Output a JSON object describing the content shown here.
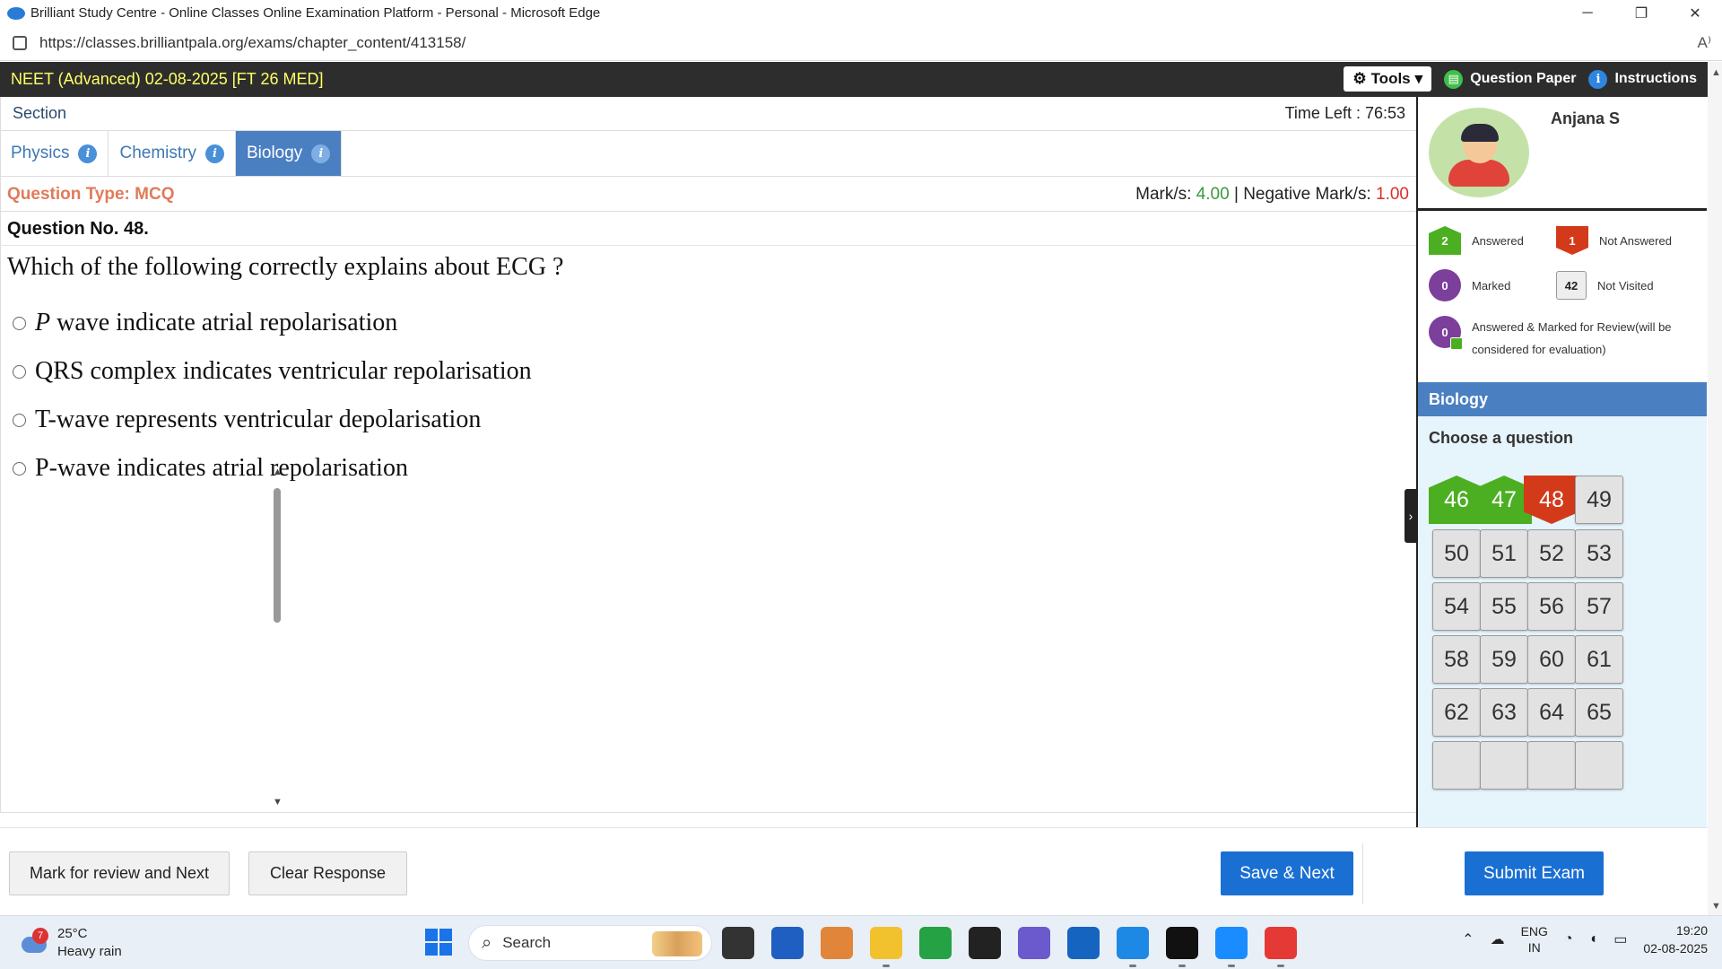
{
  "window": {
    "title": "Brilliant Study Centre - Online Classes Online Examination Platform - Personal - Microsoft Edge",
    "url": "https://classes.brilliantpala.org/exams/chapter_content/413158/",
    "controls": {
      "minimize": "─",
      "maximize": "❐",
      "close": "✕"
    },
    "read_aloud": "A⁾"
  },
  "exam_header": {
    "title": "NEET (Advanced) 02-08-2025 [FT 26 MED]",
    "tools_label": "Tools",
    "tools_icon": "⚙",
    "tools_caret": "▾",
    "question_paper_label": "Question Paper",
    "question_paper_icon": "▤",
    "instructions_label": "Instructions",
    "instructions_icon": "i"
  },
  "section_bar": {
    "label": "Section",
    "time_left": "Time Left : 76:53"
  },
  "tabs": [
    {
      "label": "Physics",
      "info": "i"
    },
    {
      "label": "Chemistry",
      "info": "i"
    },
    {
      "label": "Biology",
      "info": "i"
    }
  ],
  "question_meta": {
    "type": "Question Type: MCQ",
    "marks_label": "Mark/s:",
    "marks_value": "4.00",
    "separator": "|",
    "negative_label": "Negative Mark/s:",
    "negative_value": "1.00",
    "number": "Question No. 48."
  },
  "question": {
    "text": "Which of the following correctly explains about ECG ?",
    "options": [
      {
        "lead": "P",
        "text": " wave indicate atrial repolarisation"
      },
      {
        "lead": "",
        "text": "QRS complex indicates ventricular repolarisation"
      },
      {
        "lead": "",
        "text": "T-wave represents ventricular depolarisation"
      },
      {
        "lead": "",
        "text": "P-wave indicates atrial repolarisation"
      }
    ]
  },
  "footer": {
    "mark_review": "Mark for review and Next",
    "clear": "Clear Response",
    "save_next": "Save & Next",
    "submit": "Submit Exam"
  },
  "panel": {
    "collapse_arrow": "›",
    "user_name": "Anjana S",
    "legend": {
      "answered": {
        "count": "2",
        "label": "Answered"
      },
      "not_answered": {
        "count": "1",
        "label": "Not Answered"
      },
      "marked": {
        "count": "0",
        "label": "Marked"
      },
      "not_visited": {
        "count": "42",
        "label": "Not Visited"
      },
      "answered_marked": {
        "count": "0",
        "label": "Answered & Marked for Review(will be considered for evaluation)"
      }
    },
    "section_name": "Biology",
    "choose_label": "Choose a question",
    "questions": [
      {
        "n": "46",
        "status": "answered"
      },
      {
        "n": "47",
        "status": "answered"
      },
      {
        "n": "48",
        "status": "not_answered"
      },
      {
        "n": "49",
        "status": "not_visited"
      },
      {
        "n": "50",
        "status": "not_visited"
      },
      {
        "n": "51",
        "status": "not_visited"
      },
      {
        "n": "52",
        "status": "not_visited"
      },
      {
        "n": "53",
        "status": "not_visited"
      },
      {
        "n": "54",
        "status": "not_visited"
      },
      {
        "n": "55",
        "status": "not_visited"
      },
      {
        "n": "56",
        "status": "not_visited"
      },
      {
        "n": "57",
        "status": "not_visited"
      },
      {
        "n": "58",
        "status": "not_visited"
      },
      {
        "n": "59",
        "status": "not_visited"
      },
      {
        "n": "60",
        "status": "not_visited"
      },
      {
        "n": "61",
        "status": "not_visited"
      },
      {
        "n": "62",
        "status": "not_visited"
      },
      {
        "n": "63",
        "status": "not_visited"
      },
      {
        "n": "64",
        "status": "not_visited"
      },
      {
        "n": "65",
        "status": "not_visited"
      },
      {
        "n": "",
        "status": "not_visited"
      },
      {
        "n": "",
        "status": "not_visited"
      },
      {
        "n": "",
        "status": "not_visited"
      },
      {
        "n": "",
        "status": "not_visited"
      }
    ],
    "scroll_up": "▲",
    "scroll_down": "▼"
  },
  "page_scroll": {
    "up": "▲",
    "down": "▼"
  },
  "colors": {
    "header_bg": "#2d2d2d",
    "exam_title": "#ffff66",
    "tab_active": "#4a7fc1",
    "answered": "#4caf22",
    "not_answered": "#d33a1a",
    "marked": "#7c3f9b",
    "button_blue": "#1a6fd3",
    "panel_bg": "#e6f4fb"
  },
  "taskbar": {
    "weather_temp": "25°C",
    "weather_desc": "Heavy rain",
    "weather_badge": "7",
    "search_placeholder": "Search",
    "search_icon": "⌕",
    "apps": [
      {
        "name": "task-view-icon",
        "color": "#333"
      },
      {
        "name": "microsoft-store-icon",
        "color": "#1f5fc2"
      },
      {
        "name": "copilot-icon",
        "color": "#e0853a"
      },
      {
        "name": "file-explorer-icon",
        "color": "#f2c12e"
      },
      {
        "name": "whatsapp-icon",
        "color": "#25a244"
      },
      {
        "name": "dell-icon",
        "color": "#222"
      },
      {
        "name": "teams-icon",
        "color": "#6a5acd"
      },
      {
        "name": "outlook-icon",
        "color": "#1565c0"
      },
      {
        "name": "edge-icon",
        "color": "#1e88e5"
      },
      {
        "name": "webex-icon",
        "color": "#111"
      },
      {
        "name": "app-blue-icon",
        "color": "#1a8cff"
      },
      {
        "name": "chrome-icon",
        "color": "#e53935"
      }
    ],
    "tray_chevron": "⌃",
    "tray_cloud": "☁",
    "lang_top": "ENG",
    "lang_bottom": "IN",
    "wifi_icon": "◔",
    "volume_icon": "◖",
    "battery_icon": "▭",
    "time": "19:20",
    "date": "02-08-2025"
  }
}
